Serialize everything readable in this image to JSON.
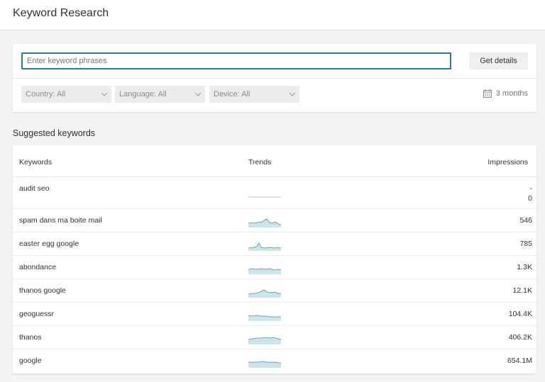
{
  "header": {
    "title": "Keyword Research"
  },
  "search": {
    "placeholder": "Enter keyword phrases",
    "button_label": "Get details",
    "filters": [
      {
        "label": "Country: All"
      },
      {
        "label": "Language: All"
      },
      {
        "label": "Device: All"
      }
    ],
    "range_label": "3 months"
  },
  "suggested": {
    "title": "Suggested keywords",
    "columns": {
      "keywords": "Keywords",
      "trends": "Trends",
      "impressions": "Impressions"
    },
    "rows": [
      {
        "keyword": "audit seo",
        "impressions": "-",
        "impressions_sub": "0"
      },
      {
        "keyword": "spam dans ma boite mail",
        "impressions": "546"
      },
      {
        "keyword": "easter egg google",
        "impressions": "785"
      },
      {
        "keyword": "abondance",
        "impressions": "1.3K"
      },
      {
        "keyword": "thanos google",
        "impressions": "12.1K"
      },
      {
        "keyword": "geoguessr",
        "impressions": "104.4K"
      },
      {
        "keyword": "thanos",
        "impressions": "406.2K"
      },
      {
        "keyword": "google",
        "impressions": "654.1M"
      }
    ]
  },
  "colors": {
    "accent": "#2f7c8f",
    "trend_fill": "#cfe3ea",
    "trend_line": "#4a8fa6"
  }
}
